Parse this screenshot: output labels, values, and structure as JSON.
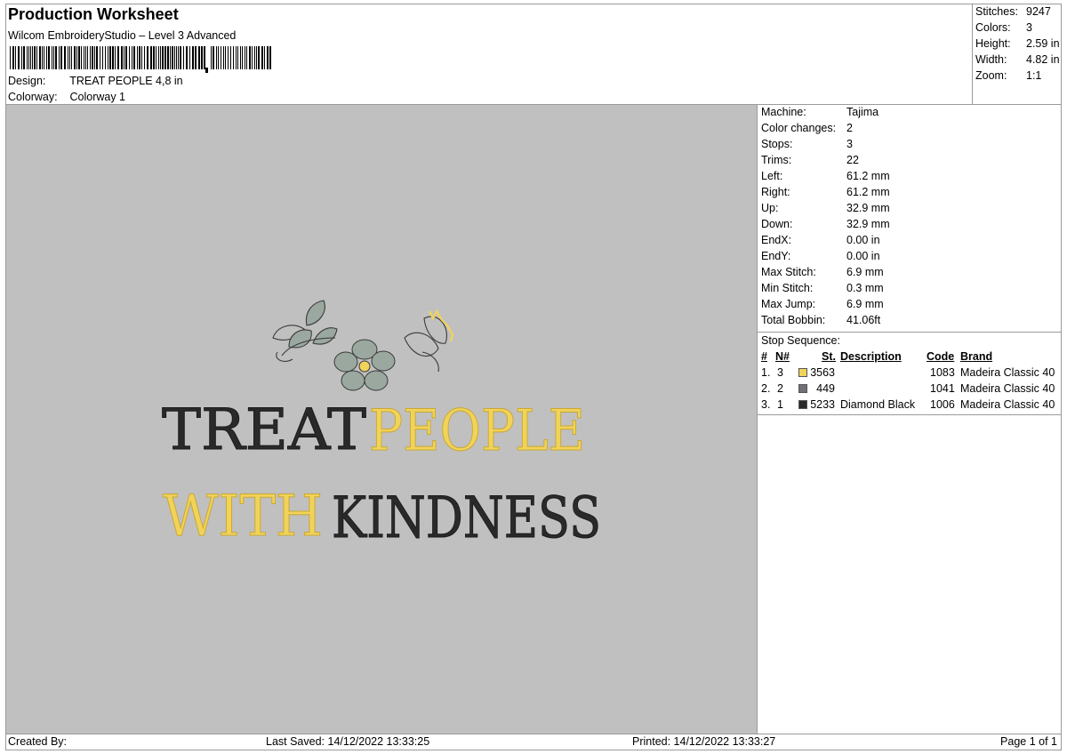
{
  "header": {
    "title": "Production Worksheet",
    "subtitle": "Wilcom EmbroideryStudio – Level 3 Advanced",
    "design_label": "Design:",
    "design_value": "TREAT PEOPLE 4,8 in",
    "colorway_label": "Colorway:",
    "colorway_value": "Colorway 1"
  },
  "summary": [
    {
      "label": "Stitches:",
      "value": "9247"
    },
    {
      "label": "Colors:",
      "value": "3"
    },
    {
      "label": "Height:",
      "value": "2.59 in"
    },
    {
      "label": "Width:",
      "value": "4.82 in"
    },
    {
      "label": "Zoom:",
      "value": "1:1"
    }
  ],
  "machine_info": [
    {
      "label": "Machine:",
      "value": "Tajima"
    },
    {
      "label": "Color changes:",
      "value": "2"
    },
    {
      "label": "Stops:",
      "value": "3"
    },
    {
      "label": "Trims:",
      "value": "22"
    },
    {
      "label": "Left:",
      "value": "61.2 mm"
    },
    {
      "label": "Right:",
      "value": "61.2 mm"
    },
    {
      "label": "Up:",
      "value": "32.9 mm"
    },
    {
      "label": "Down:",
      "value": "32.9 mm"
    },
    {
      "label": "EndX:",
      "value": "0.00 in"
    },
    {
      "label": "EndY:",
      "value": "0.00 in"
    },
    {
      "label": "Max Stitch:",
      "value": "6.9 mm"
    },
    {
      "label": "Min Stitch:",
      "value": "0.3 mm"
    },
    {
      "label": "Max Jump:",
      "value": "6.9 mm"
    },
    {
      "label": "Total Bobbin:",
      "value": "41.06ft"
    }
  ],
  "stop_sequence": {
    "title": "Stop Sequence:",
    "headers": {
      "num": "#",
      "n": "N#",
      "st": "St.",
      "description": "Description",
      "code": "Code",
      "brand": "Brand"
    },
    "rows": [
      {
        "idx": "1.",
        "n": "3",
        "color": "#f2d35a",
        "st": "3563",
        "description": "",
        "code": "1083",
        "brand": "Madeira Classic 40"
      },
      {
        "idx": "2.",
        "n": "2",
        "color": "#6e7073",
        "st": "449",
        "description": "",
        "code": "1041",
        "brand": "Madeira Classic 40"
      },
      {
        "idx": "3.",
        "n": "1",
        "color": "#2a2a2a",
        "st": "5233",
        "description": "Diamond Black",
        "code": "1006",
        "brand": "Madeira Classic 40"
      }
    ]
  },
  "design_text": {
    "line1a": "TREAT",
    "line1b": "PEOPLE",
    "line2a": "WITH",
    "line2b": "KINDNESS"
  },
  "colors": {
    "preview_bg": "#c0c0c0",
    "thread_yellow": "#f2d35a",
    "thread_gray": "#6e7073",
    "thread_black": "#2a2a2a",
    "leaf_fill": "#9aa8a0"
  },
  "footer": {
    "created_by": "Created By:",
    "last_saved": "Last Saved: 14/12/2022 13:33:25",
    "printed": "Printed: 14/12/2022 13:33:27",
    "page": "Page 1 of 1"
  }
}
